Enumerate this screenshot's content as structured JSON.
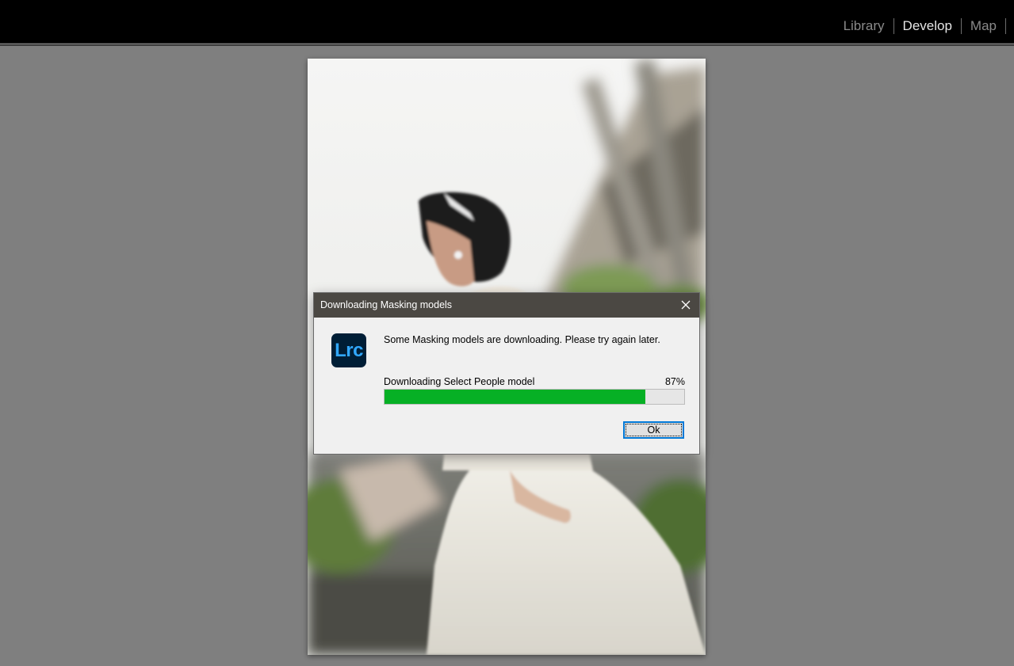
{
  "topbar": {
    "modules": [
      {
        "label": "Library",
        "active": false
      },
      {
        "label": "Develop",
        "active": true
      },
      {
        "label": "Map",
        "active": false
      }
    ]
  },
  "dialog": {
    "title": "Downloading Masking models",
    "app_icon_text": "Lrc",
    "message": "Some Masking models are downloading. Please try again later.",
    "progress_label": "Downloading Select People model",
    "progress_percent_text": "87%",
    "progress_value": 0.87,
    "ok_label": "Ok",
    "accent_color": "#0078d7",
    "progress_color": "#06b025"
  },
  "photo": {
    "subject": "bride-in-white-gown-with-tiara"
  }
}
